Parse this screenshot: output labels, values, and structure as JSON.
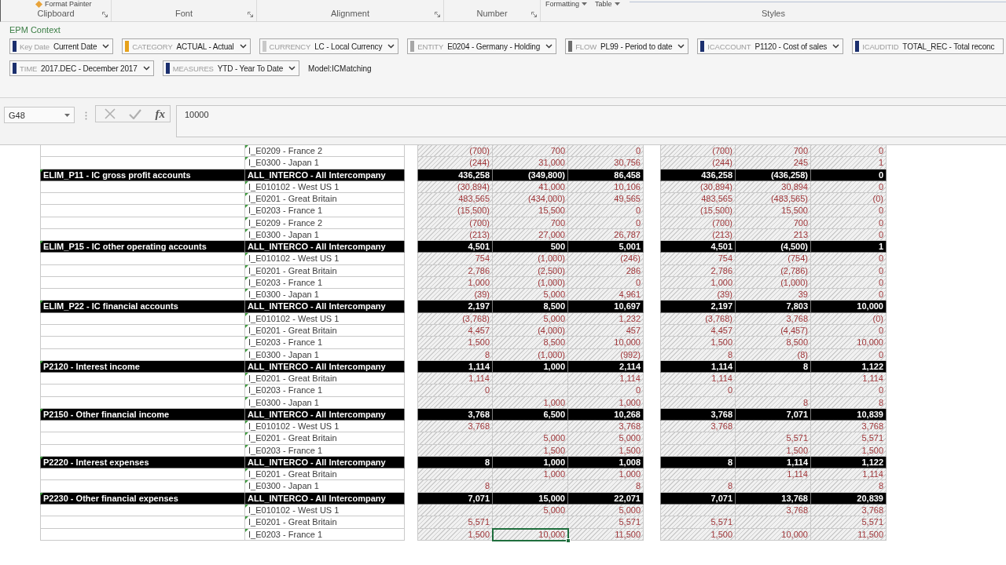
{
  "ribbon": {
    "groups": [
      {
        "label": "Clipboard",
        "launcher": true,
        "items": [
          {
            "kind": "tool",
            "label": "Format Painter"
          }
        ]
      },
      {
        "label": "Font",
        "launcher": true
      },
      {
        "label": "Alignment",
        "launcher": true
      },
      {
        "label": "Number",
        "launcher": true
      },
      {
        "label": "Styles",
        "launcher": false,
        "items": [
          {
            "kind": "menu",
            "label": "Formatting"
          },
          {
            "kind": "menu",
            "label": "Table"
          },
          {
            "kind": "gallery"
          }
        ]
      }
    ]
  },
  "context": {
    "title": "EPM Context",
    "rows": [
      {
        "selectors": [
          {
            "dimension": "Key Date",
            "value": "Current Date",
            "color": "#1b2f6e"
          },
          {
            "dimension": "CATEGORY",
            "value": "ACTUAL - Actual",
            "color": "#e6a11a"
          },
          {
            "dimension": "CURRENCY",
            "value": "LC - Local Currency",
            "color": "#c9c9c9"
          },
          {
            "dimension": "ENTITY",
            "value": "E0204 - Germany - Holding",
            "color": "#a6a6a6"
          },
          {
            "dimension": "FLOW",
            "value": "PL99 - Period to date",
            "color": "#6e6e6e"
          },
          {
            "dimension": "ICACCOUNT",
            "value": "P1120 - Cost of sales",
            "color": "#1b2f6e"
          },
          {
            "dimension": "ICAUDITID",
            "value": "TOTAL_REC - Total reconc",
            "color": "#1b2f6e"
          }
        ]
      },
      {
        "selectors": [
          {
            "dimension": "TIME",
            "value": "2017.DEC - December 2017",
            "color": "#1b2f6e"
          },
          {
            "dimension": "MEASURES",
            "value": "YTD - Year To Date",
            "color": "#1b2f6e"
          }
        ],
        "model": "Model:ICMatching"
      }
    ]
  },
  "formula_bar": {
    "name_box": "G48",
    "function_label": "fx",
    "formula": "10000"
  },
  "sheet": {
    "columns": [
      {
        "selected": false
      },
      {
        "selected": false
      },
      {
        "selected": false
      },
      {
        "selected": true
      },
      {
        "selected": false
      },
      {
        "selected": false
      },
      {
        "selected": false
      },
      {
        "selected": false
      }
    ],
    "rows": [
      {
        "kind": "item",
        "column_2": "I_E0209 - France 2",
        "flagged": true,
        "selected": false,
        "column_3": "(700)",
        "column_4": "700",
        "column_5": "0",
        "column_6": "(700)",
        "column_7": "700",
        "column_8": "0"
      },
      {
        "kind": "item",
        "column_2": "I_E0300 - Japan 1",
        "flagged": true,
        "selected": false,
        "column_3": "(244)",
        "column_4": "31,000",
        "column_5": "30,756",
        "column_6": "(244)",
        "column_7": "245",
        "column_8": "1"
      },
      {
        "kind": "group",
        "column_1": "ELIM_P11 - IC gross profit accounts",
        "column_2": "ALL_INTERCO - All Intercompany",
        "flagged": true,
        "selected": false,
        "column_3": "436,258",
        "column_4": "(349,800)",
        "column_5": "86,458",
        "column_6": "436,258",
        "column_7": "(436,258)",
        "column_8": "0"
      },
      {
        "kind": "item",
        "column_2": "I_E010102 - West US 1",
        "flagged": true,
        "selected": false,
        "column_3": "(30,894)",
        "column_4": "41,000",
        "column_5": "10,106",
        "column_6": "(30,894)",
        "column_7": "30,894",
        "column_8": "0"
      },
      {
        "kind": "item",
        "column_2": "I_E0201 - Great Britain",
        "flagged": true,
        "selected": false,
        "column_3": "483,565",
        "column_4": "(434,000)",
        "column_5": "49,565",
        "column_6": "483,565",
        "column_7": "(483,565)",
        "column_8": "(0)"
      },
      {
        "kind": "item",
        "column_2": "I_E0203 - France 1",
        "flagged": true,
        "selected": false,
        "column_3": "(15,500)",
        "column_4": "15,500",
        "column_5": "0",
        "column_6": "(15,500)",
        "column_7": "15,500",
        "column_8": "0"
      },
      {
        "kind": "item",
        "column_2": "I_E0209 - France 2",
        "flagged": true,
        "selected": false,
        "column_3": "(700)",
        "column_4": "700",
        "column_5": "0",
        "column_6": "(700)",
        "column_7": "700",
        "column_8": "0"
      },
      {
        "kind": "item",
        "column_2": "I_E0300 - Japan 1",
        "flagged": true,
        "selected": false,
        "column_3": "(213)",
        "column_4": "27,000",
        "column_5": "26,787",
        "column_6": "(213)",
        "column_7": "213",
        "column_8": "0"
      },
      {
        "kind": "group",
        "column_1": "ELIM_P15 - IC other operating accounts",
        "column_2": "ALL_INTERCO - All Intercompany",
        "flagged": true,
        "selected": false,
        "column_3": "4,501",
        "column_4": "500",
        "column_5": "5,001",
        "column_6": "4,501",
        "column_7": "(4,500)",
        "column_8": "1"
      },
      {
        "kind": "item",
        "column_2": "I_E010102 - West US 1",
        "flagged": true,
        "selected": false,
        "column_3": "754",
        "column_4": "(1,000)",
        "column_5": "(246)",
        "column_6": "754",
        "column_7": "(754)",
        "column_8": "0"
      },
      {
        "kind": "item",
        "column_2": "I_E0201 - Great Britain",
        "flagged": true,
        "selected": false,
        "column_3": "2,786",
        "column_4": "(2,500)",
        "column_5": "286",
        "column_6": "2,786",
        "column_7": "(2,786)",
        "column_8": "0"
      },
      {
        "kind": "item",
        "column_2": "I_E0203 - France 1",
        "flagged": true,
        "selected": false,
        "column_3": "1,000",
        "column_4": "(1,000)",
        "column_5": "0",
        "column_6": "1,000",
        "column_7": "(1,000)",
        "column_8": "0"
      },
      {
        "kind": "item",
        "column_2": "I_E0300 - Japan 1",
        "flagged": true,
        "selected": false,
        "column_3": "(39)",
        "column_4": "5,000",
        "column_5": "4,961",
        "column_6": "(39)",
        "column_7": "39",
        "column_8": "0"
      },
      {
        "kind": "group",
        "column_1": "ELIM_P22 - IC financial accounts",
        "column_2": "ALL_INTERCO - All Intercompany",
        "flagged": true,
        "selected": false,
        "column_3": "2,197",
        "column_4": "8,500",
        "column_5": "10,697",
        "column_6": "2,197",
        "column_7": "7,803",
        "column_8": "10,000"
      },
      {
        "kind": "item",
        "column_2": "I_E010102 - West US 1",
        "flagged": true,
        "selected": false,
        "column_3": "(3,768)",
        "column_4": "5,000",
        "column_5": "1,232",
        "column_6": "(3,768)",
        "column_7": "3,768",
        "column_8": "(0)"
      },
      {
        "kind": "item",
        "column_2": "I_E0201 - Great Britain",
        "flagged": true,
        "selected": false,
        "column_3": "4,457",
        "column_4": "(4,000)",
        "column_5": "457",
        "column_6": "4,457",
        "column_7": "(4,457)",
        "column_8": "0"
      },
      {
        "kind": "item",
        "column_2": "I_E0203 - France 1",
        "flagged": true,
        "selected": false,
        "column_3": "1,500",
        "column_4": "8,500",
        "column_5": "10,000",
        "column_6": "1,500",
        "column_7": "8,500",
        "column_8": "10,000"
      },
      {
        "kind": "item",
        "column_2": "I_E0300 - Japan 1",
        "flagged": true,
        "selected": false,
        "column_3": "8",
        "column_4": "(1,000)",
        "column_5": "(992)",
        "column_6": "8",
        "column_7": "(8)",
        "column_8": "0"
      },
      {
        "kind": "group",
        "column_1": "P2120 - Interest income",
        "column_2": "ALL_INTERCO - All Intercompany",
        "flagged": true,
        "selected": false,
        "column_3": "1,114",
        "column_4": "1,000",
        "column_5": "2,114",
        "column_6": "1,114",
        "column_7": "8",
        "column_8": "1,122"
      },
      {
        "kind": "item",
        "column_2": "I_E0201 - Great Britain",
        "flagged": true,
        "selected": false,
        "column_3": "1,114",
        "column_5": "1,114",
        "column_6": "1,114",
        "column_8": "1,114"
      },
      {
        "kind": "item",
        "column_2": "I_E0203 - France 1",
        "flagged": true,
        "selected": false,
        "column_3": "0",
        "column_5": "0",
        "column_6": "0",
        "column_8": "0"
      },
      {
        "kind": "item",
        "column_2": "I_E0300 - Japan 1",
        "flagged": true,
        "selected": false,
        "column_4": "1,000",
        "column_5": "1,000",
        "column_7": "8",
        "column_8": "8"
      },
      {
        "kind": "group",
        "column_1": "P2150 - Other financial income",
        "column_2": "ALL_INTERCO - All Intercompany",
        "flagged": true,
        "selected": false,
        "column_3": "3,768",
        "column_4": "6,500",
        "column_5": "10,268",
        "column_6": "3,768",
        "column_7": "7,071",
        "column_8": "10,839"
      },
      {
        "kind": "item",
        "column_2": "I_E010102 - West US 1",
        "flagged": true,
        "selected": false,
        "column_3": "3,768",
        "column_5": "3,768",
        "column_6": "3,768",
        "column_8": "3,768"
      },
      {
        "kind": "item",
        "column_2": "I_E0201 - Great Britain",
        "flagged": true,
        "selected": false,
        "column_4": "5,000",
        "column_5": "5,000",
        "column_7": "5,571",
        "column_8": "5,571"
      },
      {
        "kind": "item",
        "column_2": "I_E0203 - France 1",
        "flagged": true,
        "selected": false,
        "column_4": "1,500",
        "column_5": "1,500",
        "column_7": "1,500",
        "column_8": "1,500"
      },
      {
        "kind": "group",
        "column_1": "P2220 - Interest expenses",
        "column_2": "ALL_INTERCO - All Intercompany",
        "flagged": true,
        "selected": false,
        "column_3": "8",
        "column_4": "1,000",
        "column_5": "1,008",
        "column_6": "8",
        "column_7": "1,114",
        "column_8": "1,122"
      },
      {
        "kind": "item",
        "column_2": "I_E0201 - Great Britain",
        "flagged": true,
        "selected": false,
        "column_4": "1,000",
        "column_5": "1,000",
        "column_7": "1,114",
        "column_8": "1,114"
      },
      {
        "kind": "item",
        "column_2": "I_E0300 - Japan 1",
        "flagged": true,
        "selected": false,
        "column_3": "8",
        "column_5": "8",
        "column_6": "8",
        "column_8": "8"
      },
      {
        "kind": "group",
        "column_1": "P2230 - Other financial expenses",
        "column_2": "ALL_INTERCO - All Intercompany",
        "flagged": true,
        "selected": false,
        "column_3": "7,071",
        "column_4": "15,000",
        "column_5": "22,071",
        "column_6": "7,071",
        "column_7": "13,768",
        "column_8": "20,839"
      },
      {
        "kind": "item",
        "column_2": "I_E010102 - West US 1",
        "flagged": true,
        "selected": false,
        "column_4": "5,000",
        "column_5": "5,000",
        "column_7": "3,768",
        "column_8": "3,768"
      },
      {
        "kind": "item",
        "column_2": "I_E0201 - Great Britain",
        "flagged": true,
        "selected": false,
        "column_3": "5,571",
        "column_5": "5,571",
        "column_6": "5,571",
        "column_8": "5,571"
      },
      {
        "kind": "item",
        "column_2": "I_E0203 - France 1",
        "flagged": true,
        "selected": true,
        "column_3": "1,500",
        "column_4": "10,000",
        "column_5": "11,500",
        "column_6": "1,500",
        "column_7": "10,000",
        "column_8": "11,500"
      }
    ]
  }
}
